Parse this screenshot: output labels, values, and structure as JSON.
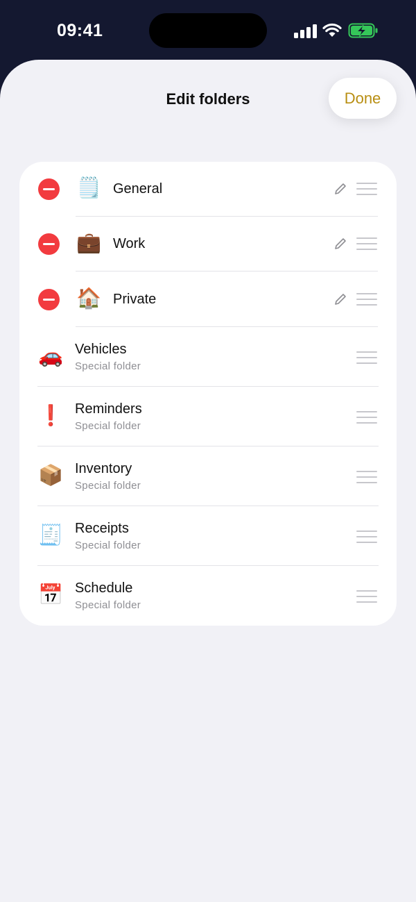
{
  "status_bar": {
    "time": "09:41"
  },
  "header": {
    "title": "Edit folders",
    "done_label": "Done"
  },
  "colors": {
    "accent": "#b88e12",
    "delete": "#f23b3f",
    "background": "#f1f1f6",
    "status_bar_bg": "#141830"
  },
  "folders": [
    {
      "name": "General",
      "icon": "notepad-icon",
      "glyph": "🗒️"
    },
    {
      "name": "Work",
      "icon": "briefcase-icon",
      "glyph": "💼"
    },
    {
      "name": "Private",
      "icon": "house-icon",
      "glyph": "🏠"
    }
  ],
  "special_folders": [
    {
      "name": "Vehicles",
      "subtitle": "Special folder",
      "icon": "car-icon",
      "glyph": "🚗"
    },
    {
      "name": "Reminders",
      "subtitle": "Special folder",
      "icon": "exclamation-icon",
      "glyph": "❗"
    },
    {
      "name": "Inventory",
      "subtitle": "Special folder",
      "icon": "package-icon",
      "glyph": "📦"
    },
    {
      "name": "Receipts",
      "subtitle": "Special folder",
      "icon": "receipt-icon",
      "glyph": "🧾"
    },
    {
      "name": "Schedule",
      "subtitle": "Special folder",
      "icon": "calendar-icon",
      "glyph": "📅"
    }
  ]
}
